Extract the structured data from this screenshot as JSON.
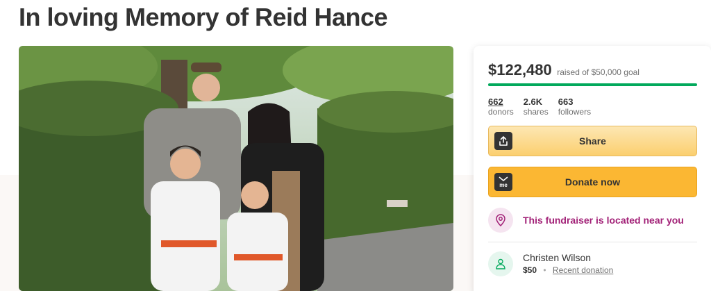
{
  "page": {
    "title": "In loving Memory of Reid Hance"
  },
  "photo": {
    "alt": ""
  },
  "fundraiser": {
    "amount_raised": "$122,480",
    "goal_text": "raised of $50,000 goal",
    "progress_fraction": 1.0,
    "stats": [
      {
        "value": "662",
        "label": "donors",
        "underline": true
      },
      {
        "value": "2.6K",
        "label": "shares",
        "underline": false
      },
      {
        "value": "663",
        "label": "followers",
        "underline": false
      }
    ],
    "share_label": "Share",
    "donate_label": "Donate now",
    "donate_icon_text": "me",
    "location_text": "This fundraiser is located near you"
  },
  "recent_donor": {
    "name": "Christen Wilson",
    "amount": "$50",
    "tag": "Recent donation"
  },
  "icons": {
    "share": "upload-share-icon",
    "donate": "gofundme-icon",
    "location": "location-pin-icon",
    "donor": "person-heart-icon"
  },
  "colors": {
    "progress": "#02a95c",
    "donate_button": "#fbb733",
    "share_button": "#fbcf6f",
    "location_text": "#a22177",
    "title": "#333333"
  }
}
